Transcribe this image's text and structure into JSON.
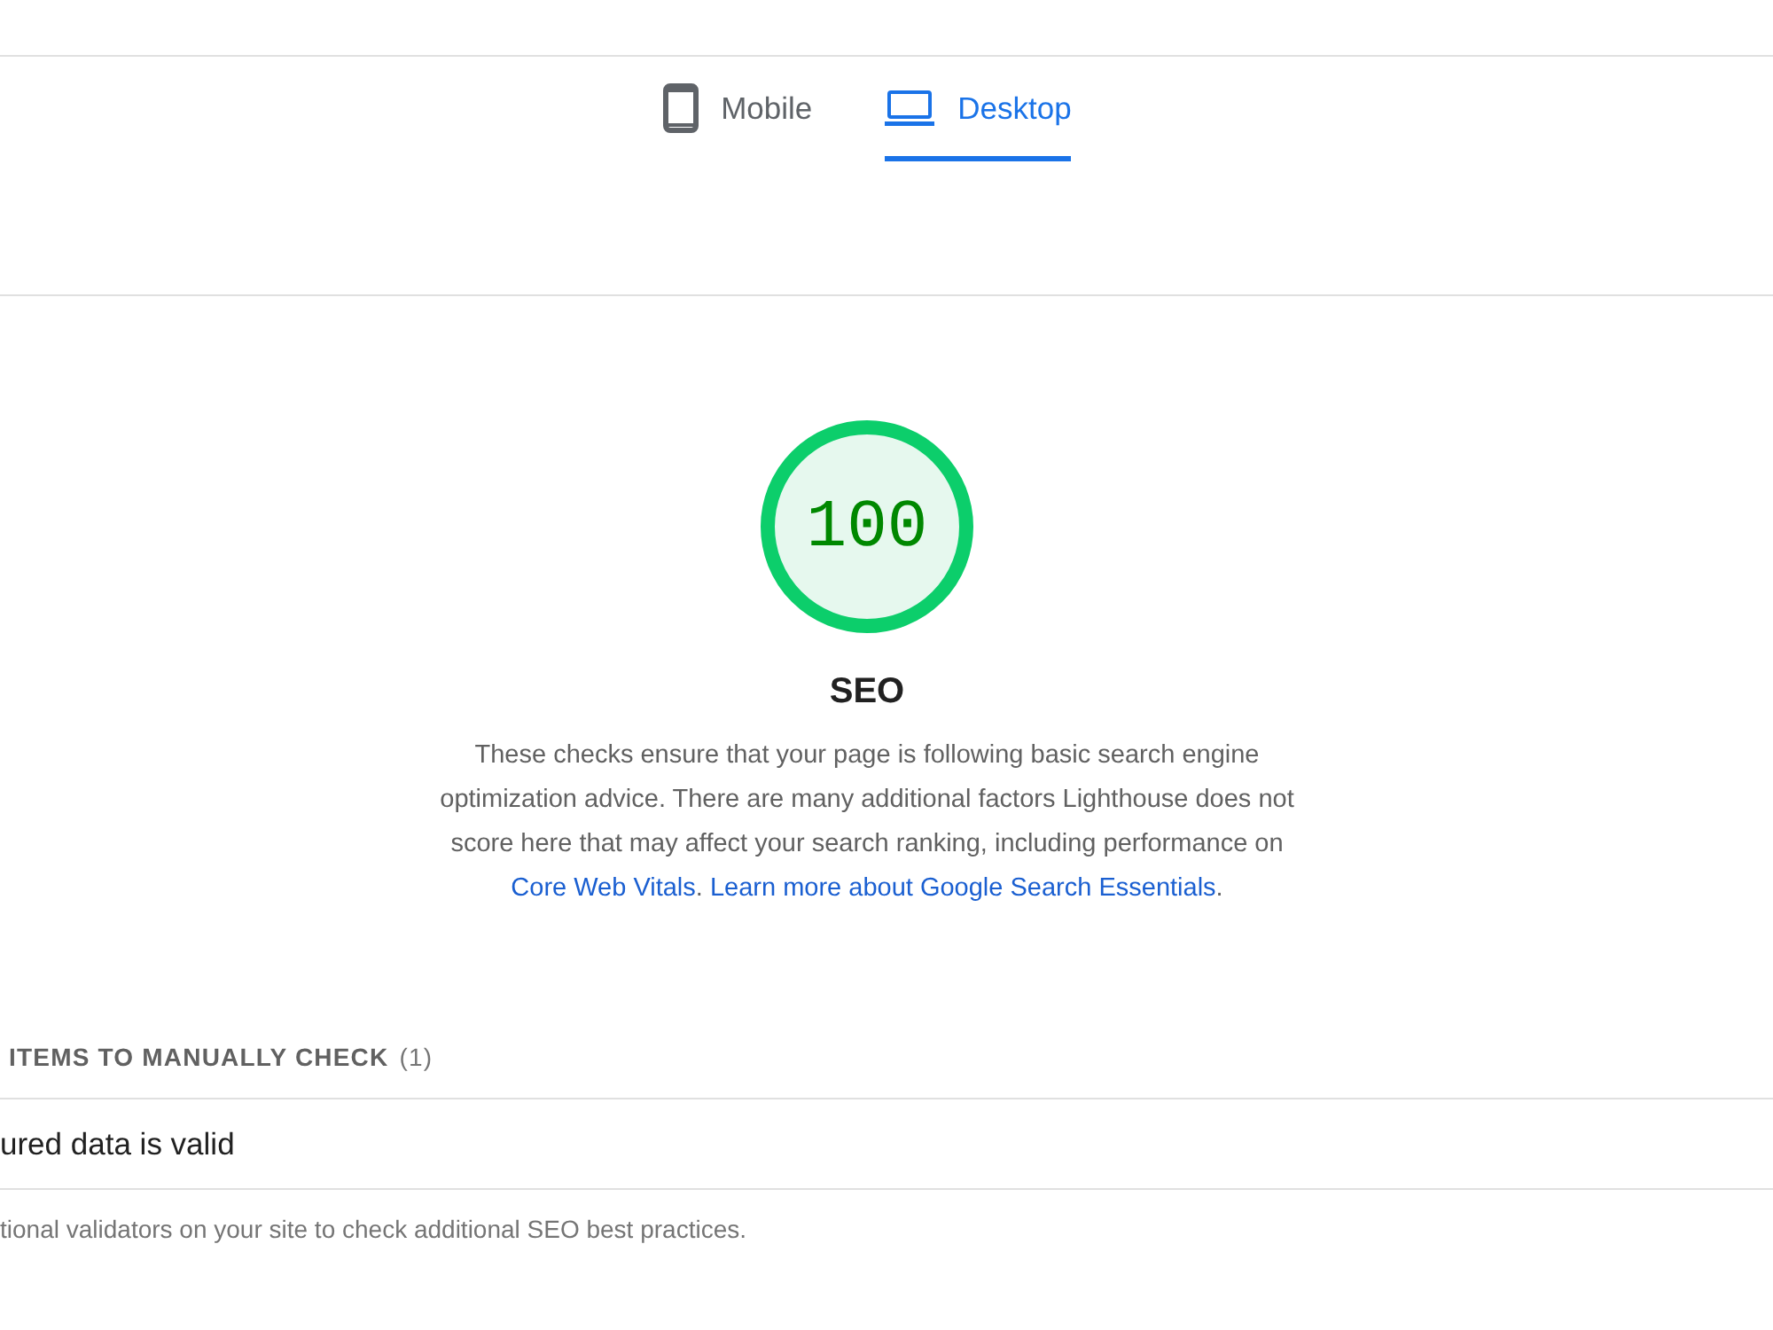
{
  "tabs": [
    {
      "label": "Mobile",
      "selected": false
    },
    {
      "label": "Desktop",
      "selected": true
    }
  ],
  "score": {
    "value": "100",
    "level": 1,
    "title": "SEO",
    "description": [
      {
        "kind": "text",
        "text": "These checks ensure that your page is following basic search engine optimization advice. There are many additional factors Lighthouse does not score here that may affect your search ranking, including performance on "
      },
      {
        "kind": "link",
        "text": "Core Web Vitals"
      },
      {
        "kind": "text",
        "text": ". "
      },
      {
        "kind": "link",
        "text": "Learn more about Google Search Essentials"
      },
      {
        "kind": "text",
        "text": "."
      }
    ]
  },
  "manual_group": {
    "title": "ITEMS TO MANUALLY CHECK",
    "count": "(1)",
    "audits": [
      {
        "title": "ured data is valid"
      }
    ],
    "description": "tional validators on your site to check additional SEO best practices."
  }
}
